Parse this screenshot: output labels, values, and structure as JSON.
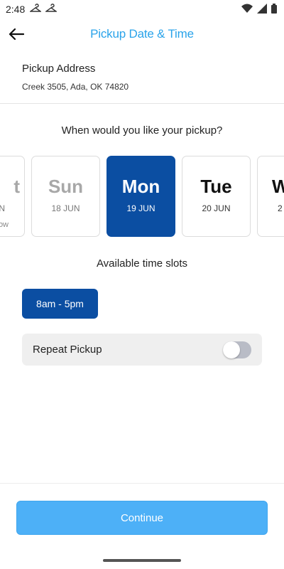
{
  "status_bar": {
    "time": "2:48",
    "left_icons": [
      "hanger-icon",
      "hanger-icon"
    ],
    "right_icons": [
      "wifi-icon",
      "signal-icon",
      "battery-icon"
    ]
  },
  "header": {
    "title": "Pickup Date & Time",
    "back_icon": "arrow-left-icon",
    "title_color": "#29a3ea"
  },
  "address": {
    "label": "Pickup Address",
    "value": "Creek 3505, Ada, OK 74820"
  },
  "question": "When would you like your pickup?",
  "days": [
    {
      "name": "t",
      "date": "N",
      "note": "ow",
      "state": "disabled"
    },
    {
      "name": "Sun",
      "date": "18 JUN",
      "note": "",
      "state": "disabled"
    },
    {
      "name": "Mon",
      "date": "19 JUN",
      "note": "",
      "state": "selected"
    },
    {
      "name": "Tue",
      "date": "20 JUN",
      "note": "",
      "state": "normal"
    },
    {
      "name": "W",
      "date": "2",
      "note": "",
      "state": "normal"
    }
  ],
  "slots": {
    "title": "Available time slots",
    "items": [
      {
        "label": "8am - 5pm",
        "selected": true
      }
    ]
  },
  "repeat": {
    "label": "Repeat Pickup",
    "enabled": false
  },
  "continue_label": "Continue",
  "colors": {
    "primary": "#0b4ea2",
    "accent": "#29a3ea",
    "continue": "#4db0f7"
  }
}
